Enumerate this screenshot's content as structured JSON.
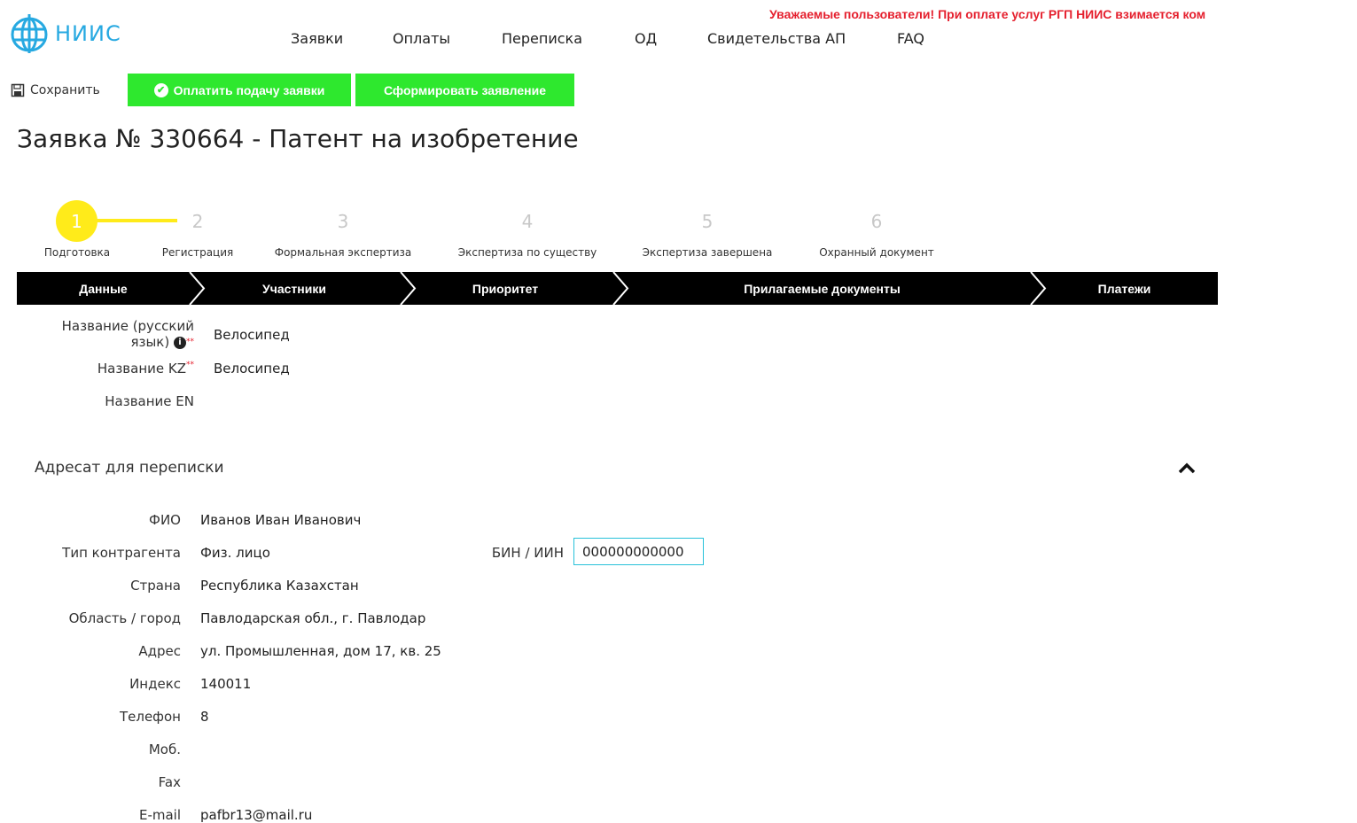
{
  "header": {
    "logo_text": "НИИС",
    "nav": [
      "Заявки",
      "Оплаты",
      "Переписка",
      "ОД",
      "Свидетельства АП",
      "FAQ"
    ],
    "announcement": "Уважаемые пользователи! При оплате услуг РГП НИИС взимается ком"
  },
  "toolbar": {
    "save_label": "Сохранить",
    "pay_label": "Оплатить подачу заявки",
    "generate_label": "Сформировать заявление"
  },
  "page_title": "Заявка № 330664 - Патент на изобретение",
  "stepper": {
    "steps": [
      {
        "num": "1",
        "label": "Подготовка"
      },
      {
        "num": "2",
        "label": "Регистрация"
      },
      {
        "num": "3",
        "label": "Формальная экспертиза"
      },
      {
        "num": "4",
        "label": "Экспертиза по существу"
      },
      {
        "num": "5",
        "label": "Экспертиза завершена"
      },
      {
        "num": "6",
        "label": "Охранный документ"
      }
    ]
  },
  "tabs": [
    "Данные",
    "Участники",
    "Приоритет",
    "Прилагаемые документы",
    "Платежи"
  ],
  "names": {
    "ru_label_line1": "Название (русский",
    "ru_label_line2": "язык)",
    "ru_value": "Велосипед",
    "kz_label": "Название KZ",
    "kz_value": "Велосипед",
    "en_label": "Название EN",
    "en_value": "",
    "required_mark": "**",
    "info_glyph": "i"
  },
  "correspondence": {
    "title": "Адресат для переписки",
    "fields": [
      {
        "label": "ФИО",
        "value": "Иванов Иван Иванович"
      },
      {
        "label": "Тип контрагента",
        "value": "Физ. лицо"
      },
      {
        "label": "Страна",
        "value": "Республика Казахстан"
      },
      {
        "label": "Область / город",
        "value": "Павлодарская обл., г. Павлодар"
      },
      {
        "label": "Адрес",
        "value": "ул. Промышленная, дом 17, кв. 25"
      },
      {
        "label": "Индекс",
        "value": "140011"
      },
      {
        "label": "Телефон",
        "value": "8"
      },
      {
        "label": "Моб.",
        "value": ""
      },
      {
        "label": "Fax",
        "value": ""
      },
      {
        "label": "E-mail",
        "value": "pafbr13@mail.ru"
      }
    ],
    "iin_label": "БИН / ИИН",
    "iin_value": "000000000000"
  },
  "colors": {
    "brand": "#27a9e1",
    "accent_green": "#2ee82e",
    "step_active": "#ffeb1a",
    "alert_red": "#e5202e"
  }
}
